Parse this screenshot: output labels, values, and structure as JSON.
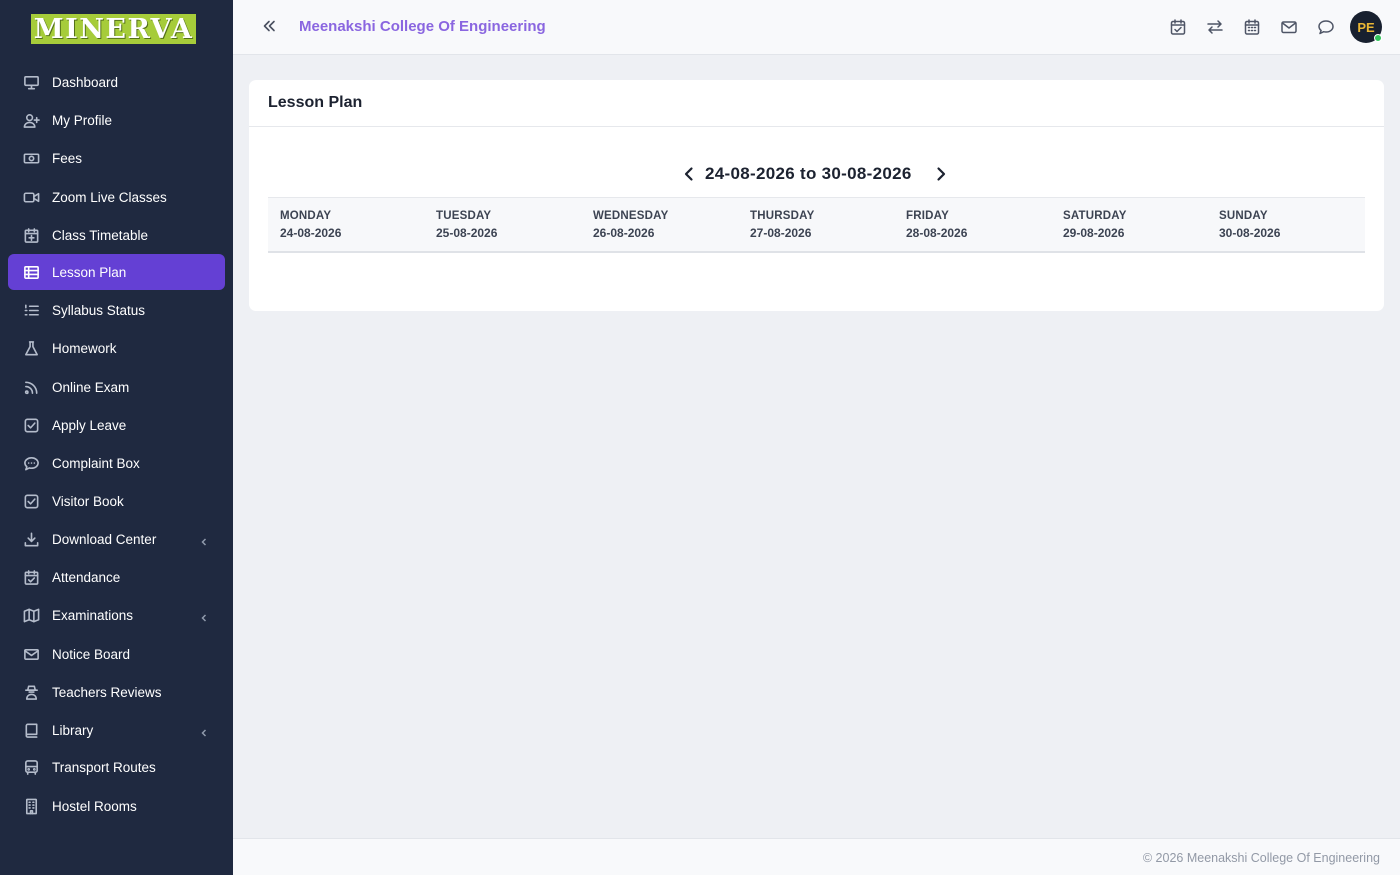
{
  "brand": {
    "logo_text": "MINERVA"
  },
  "sidebar": {
    "items": [
      {
        "label": "Dashboard",
        "icon": "monitor-icon"
      },
      {
        "label": "My Profile",
        "icon": "user-plus-icon"
      },
      {
        "label": "Fees",
        "icon": "money-icon"
      },
      {
        "label": "Zoom Live Classes",
        "icon": "video-icon"
      },
      {
        "label": "Class Timetable",
        "icon": "calendar-plus-icon"
      },
      {
        "label": "Lesson Plan",
        "icon": "list-icon",
        "active": true
      },
      {
        "label": "Syllabus Status",
        "icon": "list-ol-icon"
      },
      {
        "label": "Homework",
        "icon": "flask-icon"
      },
      {
        "label": "Online Exam",
        "icon": "rss-icon"
      },
      {
        "label": "Apply Leave",
        "icon": "check-square-icon"
      },
      {
        "label": "Complaint Box",
        "icon": "comment-dots-icon"
      },
      {
        "label": "Visitor Book",
        "icon": "check-square-icon"
      },
      {
        "label": "Download Center",
        "icon": "download-icon",
        "has_submenu": true
      },
      {
        "label": "Attendance",
        "icon": "calendar-check-icon"
      },
      {
        "label": "Examinations",
        "icon": "map-icon",
        "has_submenu": true
      },
      {
        "label": "Notice Board",
        "icon": "envelope-icon"
      },
      {
        "label": "Teachers Reviews",
        "icon": "user-secret-icon"
      },
      {
        "label": "Library",
        "icon": "book-icon",
        "has_submenu": true
      },
      {
        "label": "Transport Routes",
        "icon": "bus-icon"
      },
      {
        "label": "Hostel Rooms",
        "icon": "building-icon"
      }
    ]
  },
  "header": {
    "college_name": "Meenakshi College Of Engineering",
    "icons": [
      "calendar-check-icon",
      "exchange-icon",
      "calendar-icon",
      "mail-icon",
      "chat-icon"
    ],
    "avatar_initials": "PE",
    "user_online": true
  },
  "lesson_plan": {
    "title": "Lesson Plan",
    "week_range": "24-08-2026 to 30-08-2026",
    "days": [
      {
        "name": "MONDAY",
        "date": "24-08-2026"
      },
      {
        "name": "TUESDAY",
        "date": "25-08-2026"
      },
      {
        "name": "WEDNESDAY",
        "date": "26-08-2026"
      },
      {
        "name": "THURSDAY",
        "date": "27-08-2026"
      },
      {
        "name": "FRIDAY",
        "date": "28-08-2026"
      },
      {
        "name": "SATURDAY",
        "date": "29-08-2026"
      },
      {
        "name": "SUNDAY",
        "date": "30-08-2026"
      }
    ]
  },
  "footer": {
    "text": "© 2026 Meenakshi College Of Engineering"
  },
  "colors": {
    "sidebar_bg": "#1f2940",
    "active_item": "#6440d4",
    "brand_accent": "#8a66e0",
    "logo_bg": "#a6cc3a",
    "page_bg": "#eef0f4"
  }
}
